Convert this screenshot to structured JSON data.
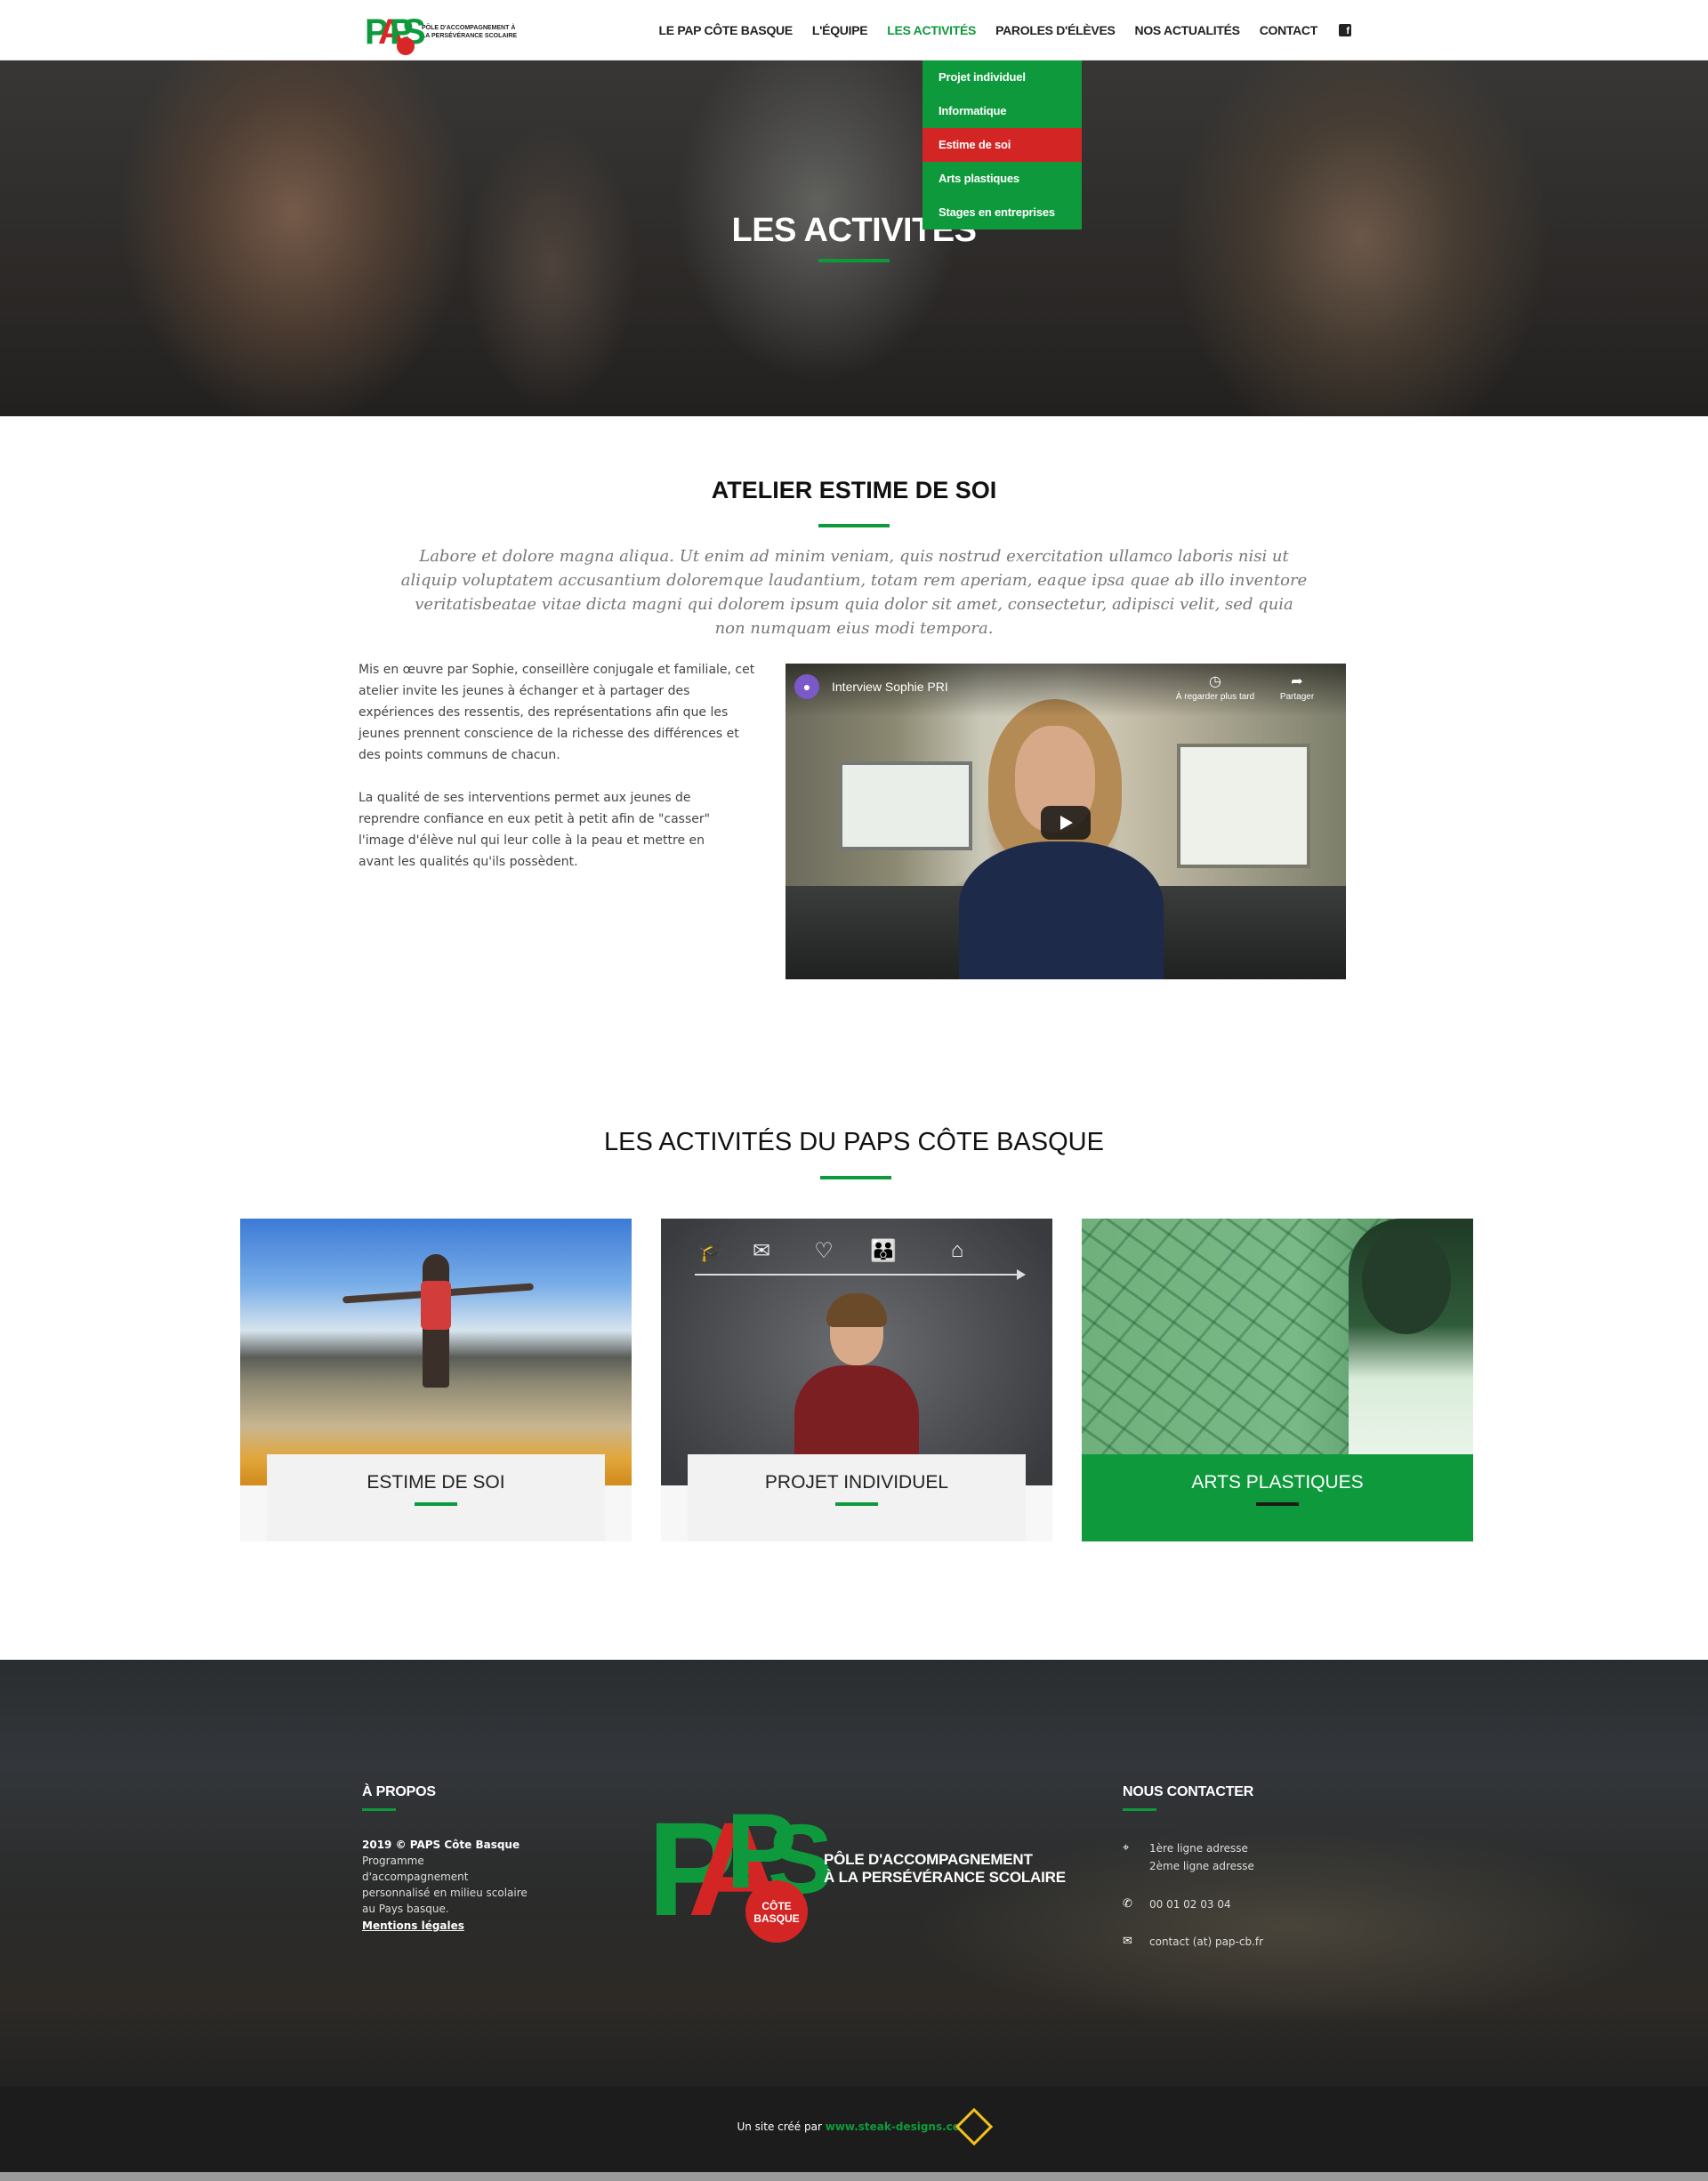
{
  "header": {
    "logo_letters": "PAPS",
    "logo_sub": "PÔLE D'ACCOMPAGNEMENT À LA PERSÉVÉRANCE SCOLAIRE",
    "nav": [
      {
        "label": "LE PAP CÔTE BASQUE"
      },
      {
        "label": "L'ÉQUIPE"
      },
      {
        "label": "LES ACTIVITÉS",
        "active": true
      },
      {
        "label": "PAROLES D'ÉLÈVES"
      },
      {
        "label": "NOS ACTUALITÉS"
      },
      {
        "label": "CONTACT"
      }
    ],
    "facebook_icon": "facebook-icon",
    "dropdown": [
      {
        "label": "Projet individuel"
      },
      {
        "label": "Informatique"
      },
      {
        "label": "Estime de soi",
        "current": true
      },
      {
        "label": "Arts plastiques"
      },
      {
        "label": "Stages en entreprises"
      }
    ]
  },
  "hero": {
    "title": "LES ACTIVITÉS"
  },
  "atelier": {
    "title": "ATELIER ESTIME DE SOI",
    "intro": "Labore et dolore magna aliqua. Ut enim ad minim veniam, quis nostrud exercitation ullamco laboris nisi ut aliquip voluptatem accusantium doloremque laudantium, totam rem aperiam, eaque ipsa quae ab illo inventore veritatisbeatae vitae dicta magni qui dolorem ipsum quia dolor sit amet, consectetur, adipisci velit, sed quia non numquam eius modi tempora.",
    "paragraph1": "Mis en œuvre par Sophie, conseillère conjugale et familiale, cet atelier invite les jeunes à échanger et à partager des expériences des ressentis, des représentations afin que les jeunes prennent conscience de la richesse des différences et des points communs de chacun.",
    "paragraph2": "La qualité de ses interventions permet aux jeunes de reprendre confiance en eux petit à petit afin de \"casser\" l'image d'élève nul qui leur colle à la peau et mettre en avant les qualités qu'ils possèdent."
  },
  "video": {
    "title": "Interview Sophie PRI",
    "watch_later": "À regarder plus tard",
    "share": "Partager",
    "clock_icon": "clock-icon",
    "share_icon": "share-icon",
    "play_icon": "play-icon"
  },
  "activities": {
    "title": "LES ACTIVITÉS DU PAPS CÔTE BASQUE",
    "cards": [
      {
        "label": "ESTIME DE SOI"
      },
      {
        "label": "PROJET INDIVIDUEL"
      },
      {
        "label": "ARTS PLASTIQUES",
        "highlighted": true
      }
    ]
  },
  "footer": {
    "about_title": "À PROPOS",
    "about_year": "2019 © PAPS Côte Basque",
    "about_text": "Programme d'accompagnement personnalisé en milieu scolaire au Pays basque.",
    "legal_link": "Mentions légales",
    "logo_letters": "PAPS",
    "logo_seal": "CÔTE BASQUE",
    "tagline_line1": "PÔLE D'ACCOMPAGNEMENT",
    "tagline_line2": "À LA PERSÉVÉRANCE SCOLAIRE",
    "contact_title": "NOUS CONTACTER",
    "address_line1": "1ère ligne adresse",
    "address_line2": "2ème ligne adresse",
    "phone": "00 01 02 03 04",
    "email": "contact (at) pap-cb.fr",
    "credit_prefix": "Un site créé par",
    "credit_link": "www.steak-designs.com",
    "icons": [
      "map-marker-icon",
      "phone-icon",
      "envelope-icon"
    ]
  },
  "colors": {
    "accent_green": "#0e9a3c",
    "accent_red": "#d42525"
  }
}
